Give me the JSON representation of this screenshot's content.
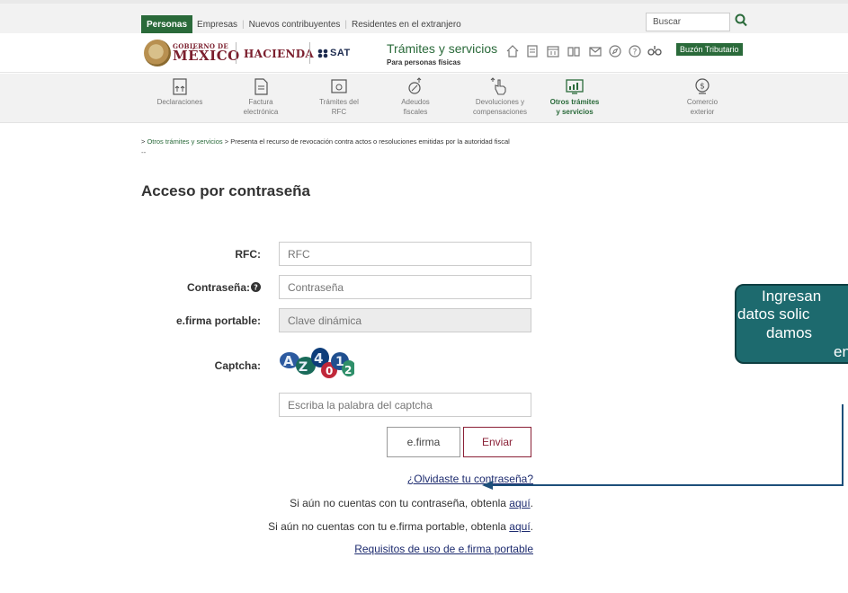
{
  "topnav": {
    "personas": "Personas",
    "empresas": "Empresas",
    "nuevos": "Nuevos contribuyentes",
    "residentes": "Residentes en el extranjero",
    "search_placeholder": "Buscar"
  },
  "brand": {
    "gobierno_small": "GOBIERNO DE",
    "gobierno_big": "MÉXICO",
    "hacienda": "HACIENDA",
    "sat": "SAT",
    "tramites_title": "Trámites y servicios",
    "tramites_sub": "Para personas físicas",
    "buzon": "Buzón Tributario"
  },
  "categories": [
    {
      "label1": "Declaraciones",
      "label2": ""
    },
    {
      "label1": "Factura",
      "label2": "electrónica"
    },
    {
      "label1": "Trámites del",
      "label2": "RFC"
    },
    {
      "label1": "Adeudos",
      "label2": "fiscales"
    },
    {
      "label1": "Devoluciones y",
      "label2": "compensaciones"
    },
    {
      "label1": "Otros trámites",
      "label2": "y servicios"
    },
    {
      "label1": "Comercio",
      "label2": "exterior"
    }
  ],
  "breadcrumb": {
    "prefix": "> ",
    "link": "Otros trámites y servicios",
    "sep": " > ",
    "current": "Presenta el recurso de revocación contra actos o resoluciones emitidas por la autoridad fiscal",
    "dash": "--"
  },
  "form": {
    "title": "Acceso por contraseña",
    "rfc_label": "RFC:",
    "rfc_placeholder": "RFC",
    "password_label": "Contraseña:",
    "password_placeholder": "Contraseña",
    "efirma_label": "e.firma portable:",
    "efirma_placeholder": "Clave dinámica",
    "captcha_label": "Captcha:",
    "captcha_placeholder": "Escriba la palabra del captcha",
    "captcha_code": "AZ4012",
    "btn_efirma": "e.firma",
    "btn_enviar": "Enviar"
  },
  "links": {
    "forgot": "¿Olvidaste tu contraseña?",
    "no_password_text": "Si aún no cuentas con tu contraseña, obtenla ",
    "no_efirma_text": "Si aún no cuentas con tu e.firma portable, obtenla ",
    "aqui": "aquí",
    "period": ".",
    "requisitos": "Requisitos de uso de e.firma portable"
  },
  "callout": {
    "line1": "Ingresan",
    "line2": "datos solic",
    "line3": "damos",
    "line4": "env"
  },
  "colors": {
    "green": "#2a6a3a",
    "maroon": "#8a2036",
    "callout": "#1d6a6e",
    "link": "#1d2b6f"
  }
}
